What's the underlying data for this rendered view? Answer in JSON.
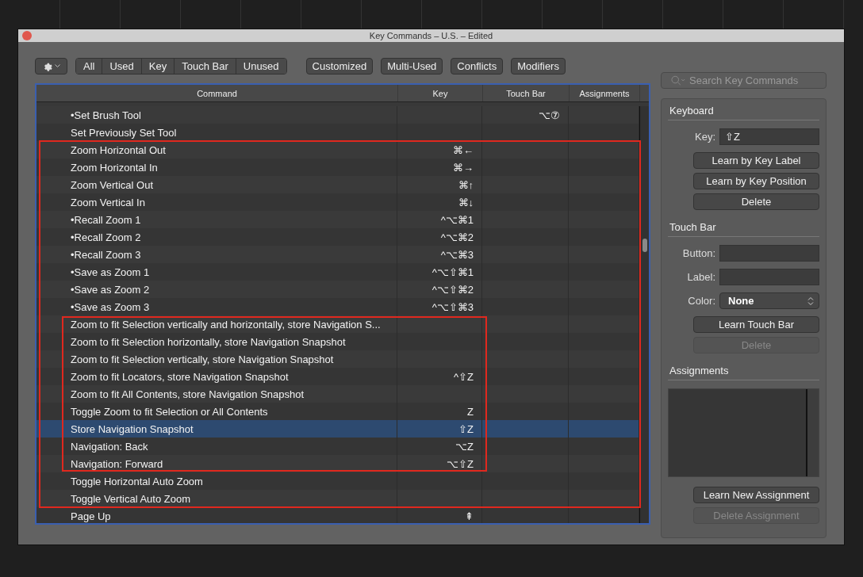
{
  "window": {
    "title": "Key Commands – U.S. – Edited"
  },
  "filter_tabs": [
    "All",
    "Used",
    "Key",
    "Touch Bar",
    "Unused"
  ],
  "toggle_buttons": [
    "Customized",
    "Multi-Used",
    "Conflicts",
    "Modifiers"
  ],
  "search": {
    "placeholder": "Search Key Commands"
  },
  "table": {
    "columns": [
      "Command",
      "Key",
      "Touch Bar",
      "Assignments"
    ],
    "rows": [
      {
        "command": "•Set Brush Tool",
        "key": "",
        "touch_bar": "⌥⑦",
        "selected": false
      },
      {
        "command": "Set Previously Set Tool",
        "key": "",
        "touch_bar": "",
        "selected": false
      },
      {
        "command": "Zoom Horizontal Out",
        "key": "⌘←",
        "touch_bar": "",
        "selected": false
      },
      {
        "command": "Zoom Horizontal In",
        "key": "⌘→",
        "touch_bar": "",
        "selected": false
      },
      {
        "command": "Zoom Vertical Out",
        "key": "⌘↑",
        "touch_bar": "",
        "selected": false
      },
      {
        "command": "Zoom Vertical In",
        "key": "⌘↓",
        "touch_bar": "",
        "selected": false
      },
      {
        "command": "•Recall Zoom 1",
        "key": "^⌥⌘1",
        "touch_bar": "",
        "selected": false
      },
      {
        "command": "•Recall Zoom 2",
        "key": "^⌥⌘2",
        "touch_bar": "",
        "selected": false
      },
      {
        "command": "•Recall Zoom 3",
        "key": "^⌥⌘3",
        "touch_bar": "",
        "selected": false
      },
      {
        "command": "•Save as Zoom 1",
        "key": "^⌥⇧⌘1",
        "touch_bar": "",
        "selected": false
      },
      {
        "command": "•Save as Zoom 2",
        "key": "^⌥⇧⌘2",
        "touch_bar": "",
        "selected": false
      },
      {
        "command": "•Save as Zoom 3",
        "key": "^⌥⇧⌘3",
        "touch_bar": "",
        "selected": false
      },
      {
        "command": "Zoom to fit Selection vertically and horizontally, store Navigation S...",
        "key": "",
        "touch_bar": "",
        "selected": false
      },
      {
        "command": "Zoom to fit Selection horizontally, store Navigation Snapshot",
        "key": "",
        "touch_bar": "",
        "selected": false
      },
      {
        "command": "Zoom to fit Selection vertically, store Navigation Snapshot",
        "key": "",
        "touch_bar": "",
        "selected": false
      },
      {
        "command": "Zoom to fit Locators, store Navigation Snapshot",
        "key": "^⇧Z",
        "touch_bar": "",
        "selected": false
      },
      {
        "command": "Zoom to fit All Contents, store Navigation Snapshot",
        "key": "",
        "touch_bar": "",
        "selected": false
      },
      {
        "command": "Toggle Zoom to fit Selection or All Contents",
        "key": "Z",
        "touch_bar": "",
        "selected": false
      },
      {
        "command": "Store Navigation Snapshot",
        "key": "⇧Z",
        "touch_bar": "",
        "selected": true
      },
      {
        "command": "Navigation: Back",
        "key": "⌥Z",
        "touch_bar": "",
        "selected": false
      },
      {
        "command": "Navigation: Forward",
        "key": "⌥⇧Z",
        "touch_bar": "",
        "selected": false
      },
      {
        "command": "Toggle Horizontal Auto Zoom",
        "key": "",
        "touch_bar": "",
        "selected": false
      },
      {
        "command": "Toggle Vertical Auto Zoom",
        "key": "",
        "touch_bar": "",
        "selected": false
      },
      {
        "command": "Page Up",
        "key": "⇞",
        "touch_bar": "",
        "selected": false
      }
    ]
  },
  "inspector": {
    "keyboard": {
      "title": "Keyboard",
      "key_label": "Key:",
      "key_value": "⇧Z",
      "buttons": [
        {
          "label": "Learn by Key Label",
          "disabled": false
        },
        {
          "label": "Learn by Key Position",
          "disabled": false
        },
        {
          "label": "Delete",
          "disabled": false
        }
      ]
    },
    "touch_bar": {
      "title": "Touch Bar",
      "button_label": "Button:",
      "label_label": "Label:",
      "color_label": "Color:",
      "color_value": "None",
      "buttons": [
        {
          "label": "Learn Touch Bar",
          "disabled": false
        },
        {
          "label": "Delete",
          "disabled": true
        }
      ]
    },
    "assignments": {
      "title": "Assignments",
      "buttons": [
        {
          "label": "Learn New Assignment",
          "disabled": false
        },
        {
          "label": "Delete Assignment",
          "disabled": true
        }
      ]
    }
  }
}
